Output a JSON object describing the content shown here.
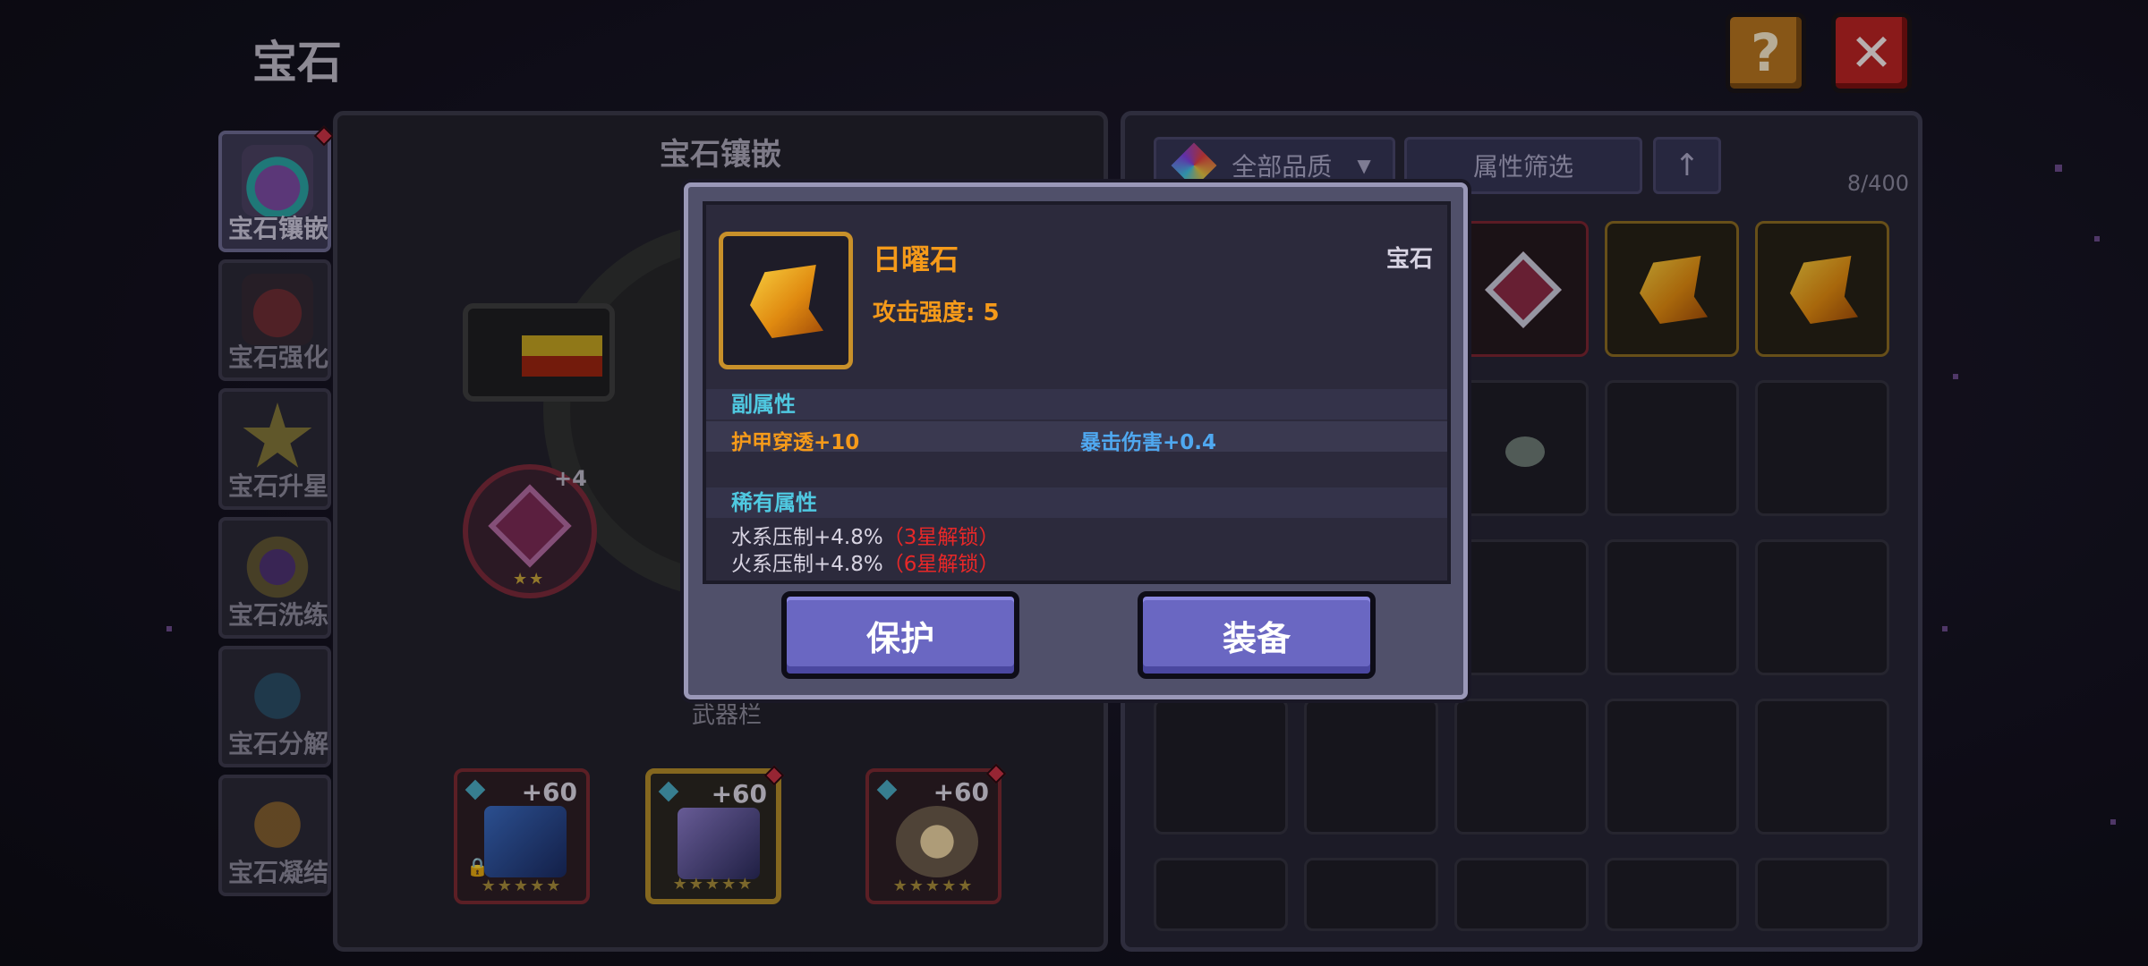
{
  "page_title": "宝石",
  "header": {
    "help_label": "?",
    "close_label": "✕"
  },
  "tabs": [
    {
      "label": "宝石镶嵌",
      "active": true
    },
    {
      "label": "宝石强化",
      "active": false
    },
    {
      "label": "宝石升星",
      "active": false
    },
    {
      "label": "宝石洗练",
      "active": false
    },
    {
      "label": "宝石分解",
      "active": false
    },
    {
      "label": "宝石凝结",
      "active": false
    }
  ],
  "inlay": {
    "title": "宝石镶嵌",
    "slot_level": "+4",
    "slot_stars": "★★",
    "weapon_bar_label": "武器栏",
    "weapons": [
      {
        "level": "+60",
        "stars": "★★★★★",
        "locked": true
      },
      {
        "level": "+60",
        "stars": "★★★★★",
        "locked": false
      },
      {
        "level": "+60",
        "stars": "★★★★★",
        "locked": false
      }
    ]
  },
  "bag": {
    "quality_filter": "全部品质",
    "attr_filter": "属性筛选",
    "sort_icon": "↑",
    "count": "8/400"
  },
  "modal": {
    "item_name": "日曜石",
    "item_type": "宝石",
    "main_stat": "攻击强度: 5",
    "sub_title": "副属性",
    "sub_stats": [
      "护甲穿透+10",
      "暴击伤害+0.4"
    ],
    "rare_title": "稀有属性",
    "rare_stats": [
      {
        "text": "水系压制+4.8%",
        "lock": "（3星解锁）"
      },
      {
        "text": "火系压制+4.8%",
        "lock": "（6星解锁）"
      }
    ],
    "protect_label": "保护",
    "equip_label": "装备"
  },
  "colors": {
    "accent_orange": "#f59a1a",
    "accent_cyan": "#4fc8e0",
    "accent_blue": "#4fa8f0",
    "lock_red": "#e82828",
    "button_purple": "#6a67c2"
  }
}
